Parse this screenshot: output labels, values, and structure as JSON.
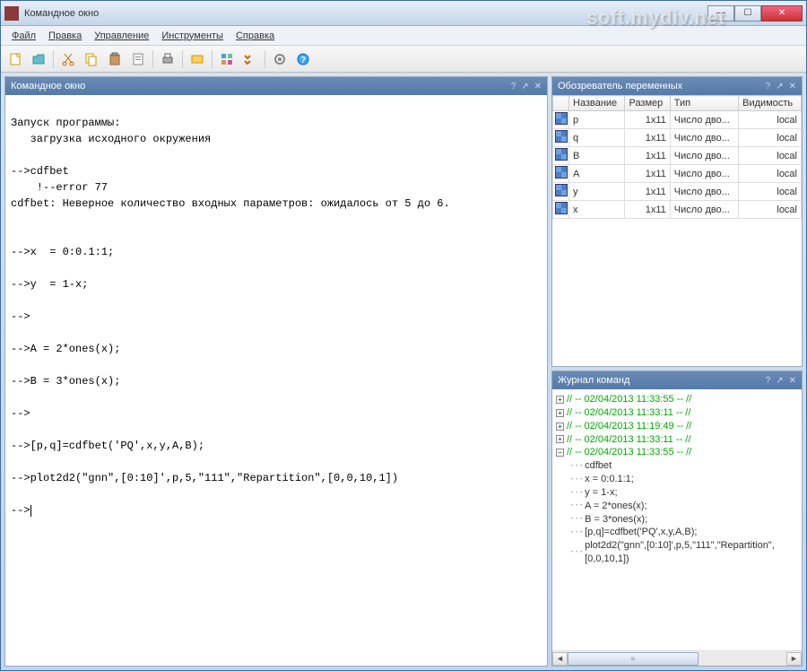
{
  "window": {
    "title": "Командное окно"
  },
  "watermark": "soft.mydiv.net",
  "menubar": {
    "file": "Файл",
    "edit": "Правка",
    "control": "Управление",
    "tools": "Инструменты",
    "help": "Справка"
  },
  "panels": {
    "console_title": "Командное окно",
    "vars_title": "Обозреватель переменных",
    "history_title": "Журнал команд"
  },
  "console_text": "\nЗапуск программы:\n   загрузка исходного окружения\n\n-->cdfbet\n    !--error 77\ncdfbet: Неверное количество входных параметров: ожидалось от 5 до 6.\n\n\n-->x  = 0:0.1:1;\n\n-->y  = 1-x;\n\n-->\n\n-->A = 2*ones(x);\n\n-->B = 3*ones(x);\n\n-->\n\n-->[p,q]=cdfbet('PQ',x,y,A,B);\n\n-->plot2d2(\"gnn\",[0:10]',p,5,\"111\",\"Repartition\",[0,0,10,1])\n\n-->",
  "vars": {
    "headers": {
      "name": "Название",
      "size": "Размер",
      "type": "Тип",
      "visibility": "Видимость"
    },
    "rows": [
      {
        "name": "p",
        "size": "1x11",
        "type": "Число дво...",
        "visibility": "local"
      },
      {
        "name": "q",
        "size": "1x11",
        "type": "Число дво...",
        "visibility": "local"
      },
      {
        "name": "B",
        "size": "1x11",
        "type": "Число дво...",
        "visibility": "local"
      },
      {
        "name": "A",
        "size": "1x11",
        "type": "Число дво...",
        "visibility": "local"
      },
      {
        "name": "y",
        "size": "1x11",
        "type": "Число дво...",
        "visibility": "local"
      },
      {
        "name": "x",
        "size": "1x11",
        "type": "Число дво...",
        "visibility": "local"
      }
    ]
  },
  "history": {
    "timestamps": [
      "// -- 02/04/2013 11:33:55 -- //",
      "// -- 02/04/2013 11:33:11 -- //",
      "// -- 02/04/2013 11:19:49 -- //",
      "// -- 02/04/2013 11:33:11 -- //",
      "// -- 02/04/2013 11:33:55 -- //"
    ],
    "commands": [
      "cdfbet",
      "x  = 0:0.1:1;",
      "y  = 1-x;",
      "A = 2*ones(x);",
      "B = 3*ones(x);",
      "[p,q]=cdfbet('PQ',x,y,A,B);",
      "plot2d2(\"gnn\",[0:10]',p,5,\"111\",\"Repartition\",[0,0,10,1])"
    ]
  },
  "icons": {
    "new": "new-file-icon",
    "open": "open-icon",
    "cut": "cut-icon",
    "copy": "copy-icon",
    "paste": "paste-icon",
    "clipboard": "clipboard-icon",
    "print": "print-icon",
    "module": "module-icon",
    "apps": "apps-icon",
    "prefs": "prefs-icon",
    "gear": "gear-icon",
    "help": "help-icon"
  }
}
